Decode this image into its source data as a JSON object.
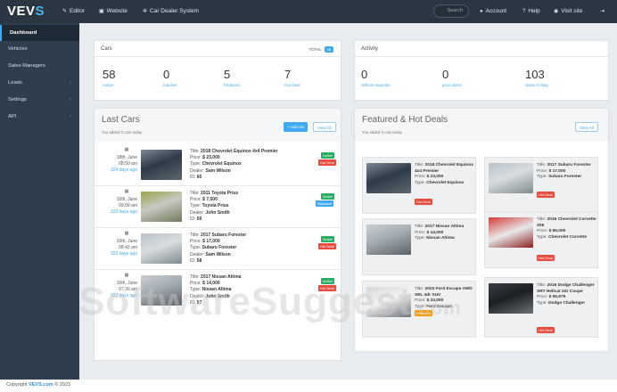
{
  "app": {
    "logo_main": "VEV",
    "logo_accent": "S"
  },
  "topnav": {
    "editor": "Editor",
    "website": "Website",
    "car_dealer_system": "Car Dealer System",
    "search_placeholder": "Search",
    "account": "Account",
    "help": "Help",
    "visit_site": "Visit site"
  },
  "sidebar": {
    "items": [
      {
        "label": "Dashboard"
      },
      {
        "label": "Vehicles"
      },
      {
        "label": "Sales Managers"
      },
      {
        "label": "Leads"
      },
      {
        "label": "Settings"
      },
      {
        "label": "API"
      }
    ]
  },
  "cars_panel": {
    "title": "Cars",
    "total_label": "TOTAL",
    "total_value": "58",
    "stats": [
      {
        "num": "58",
        "label": "Active"
      },
      {
        "num": "0",
        "label": "Inactive"
      },
      {
        "num": "5",
        "label": "Featured"
      },
      {
        "num": "7",
        "label": "Hot Deal"
      }
    ]
  },
  "activity_panel": {
    "title": "Activity",
    "stats": [
      {
        "num": "0",
        "label": "vehicle requests"
      },
      {
        "num": "0",
        "label": "price alerts"
      },
      {
        "num": "103",
        "label": "views in May"
      }
    ]
  },
  "last_cars": {
    "title": "Last Cars",
    "subtitle": "You added 0 cars today",
    "add_button": "+ Add car",
    "view_all": "View All",
    "rows": [
      {
        "date": "18th, June",
        "time": "08:50 am",
        "ago": "324 days ago",
        "title": "2018 Chevrolet Equinox 4x4 Premier",
        "price": "$ 23,000",
        "type": "Chevrolet Equinox",
        "dealer": "Sam Wilson",
        "id": "60",
        "tags": [
          "Active",
          "Hot Deal"
        ]
      },
      {
        "date": "16th, June",
        "time": "09:09 am",
        "ago": "322 days ago",
        "title": "2011 Toyota Prius",
        "price": "$ 7,500",
        "type": "Toyota Prius",
        "dealer": "John Smith",
        "id": "59",
        "tags": [
          "Active",
          "Standard"
        ]
      },
      {
        "date": "16th, June",
        "time": "08:42 am",
        "ago": "322 days ago",
        "title": "2017 Subaru Forester",
        "price": "$ 17,000",
        "type": "Subaru Forester",
        "dealer": "Sam Wilson",
        "id": "58",
        "tags": [
          "Active",
          "Hot Deal"
        ]
      },
      {
        "date": "16th, June",
        "time": "07:30 am",
        "ago": "322 days ago",
        "title": "2017 Nissan Altima",
        "price": "$ 14,000",
        "type": "Nissan Altima",
        "dealer": "John Smith",
        "id": "57",
        "tags": [
          "Active",
          "Hot Deal"
        ]
      }
    ],
    "labels": {
      "title": "Title:",
      "price": "Price:",
      "type": "Type:",
      "dealer": "Dealer:",
      "id": "ID:"
    }
  },
  "featured": {
    "title": "Featured & Hot Deals",
    "subtitle": "You added 0 cars today",
    "view_all": "View All",
    "deals": [
      {
        "title": "2018 Chevrolet Equinox 4x4 Premier",
        "price": "$ 23,000",
        "type": "Chevrolet Equinox",
        "tag": "Hot Deal"
      },
      {
        "title": "2017 Subaru Forester",
        "price": "$ 17,000",
        "type": "Subaru Forester",
        "tag": "Hot Deal"
      },
      {
        "title": "2017 Nissan Altima",
        "price": "$ 14,000",
        "type": "Nissan Altima",
        "tag": "Hot Deal"
      },
      {
        "title": "2016 Chevrolet Corvette Z06",
        "price": "$ 65,000",
        "type": "Chevrolet Corvette",
        "tag": "Hot Deal"
      },
      {
        "title": "2020 Ford Escape AWD SEL 4dr SUV",
        "price": "$ 24,000",
        "type": "Ford Escape",
        "tag": "Featured"
      },
      {
        "title": "2016 Dodge Challenger SRT Hellcat 2dr Coupe",
        "price": "$ 55,975",
        "type": "Dodge Challenger",
        "tag": "Hot Deal"
      }
    ]
  },
  "footer": {
    "prefix": "Copyright",
    "brand": "VEVS.com",
    "suffix": "© 2023"
  },
  "watermark": {
    "main": "SoftwareSuggest",
    "suffix": ".com"
  }
}
